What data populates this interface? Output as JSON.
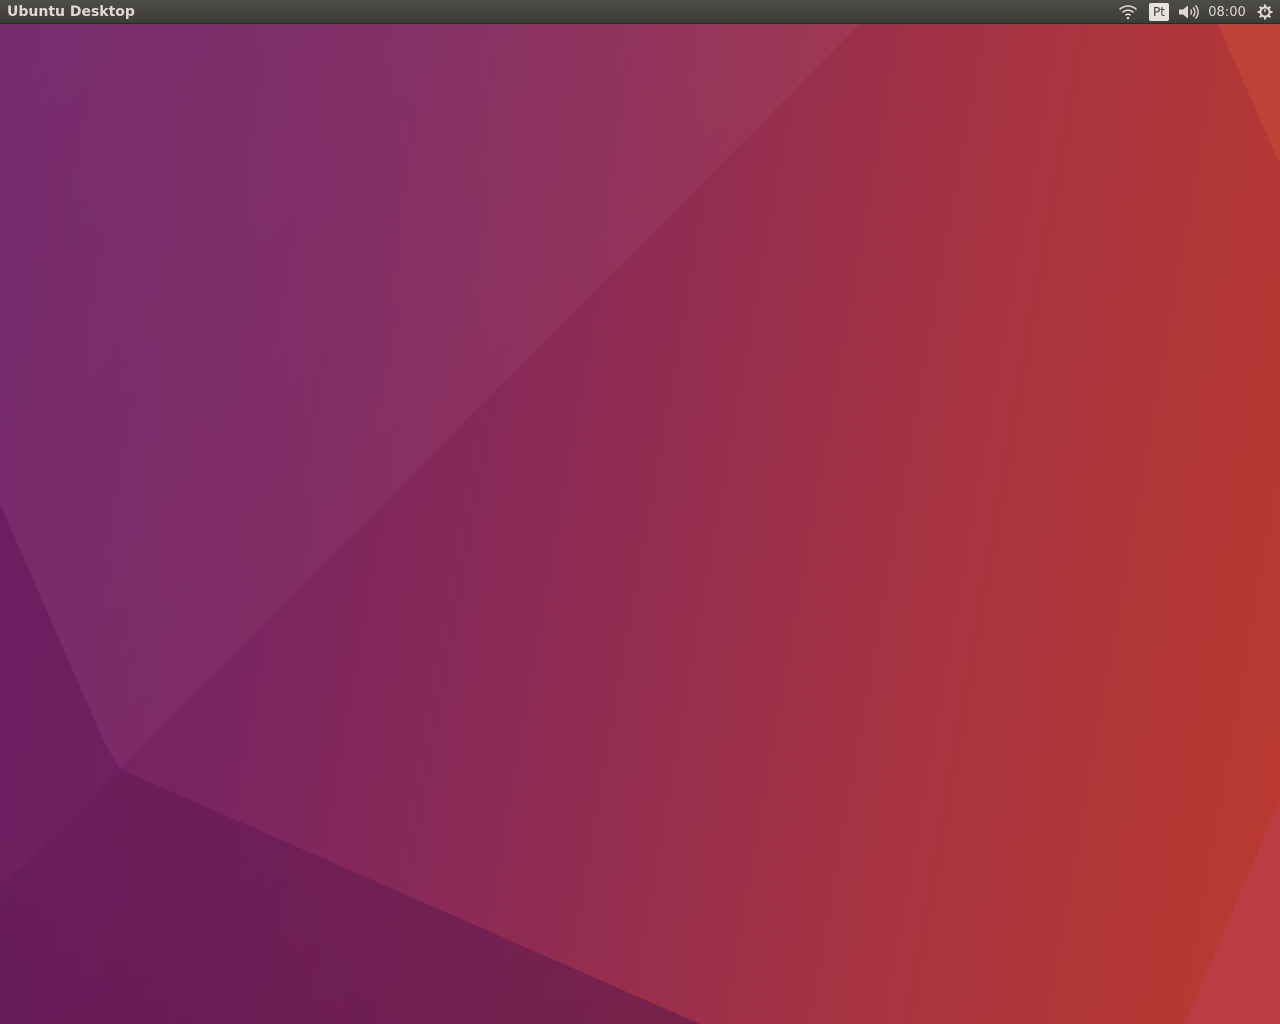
{
  "panel": {
    "app_title": "Ubuntu Desktop",
    "indicators": {
      "network_icon": "wifi-icon",
      "keyboard_layout": "Pt",
      "sound_icon": "volume-icon",
      "clock": "08:00",
      "session_icon": "gear-icon"
    }
  },
  "desktop": {
    "wallpaper_colors": [
      "#6d1f66",
      "#922d52",
      "#bb3a30"
    ]
  }
}
